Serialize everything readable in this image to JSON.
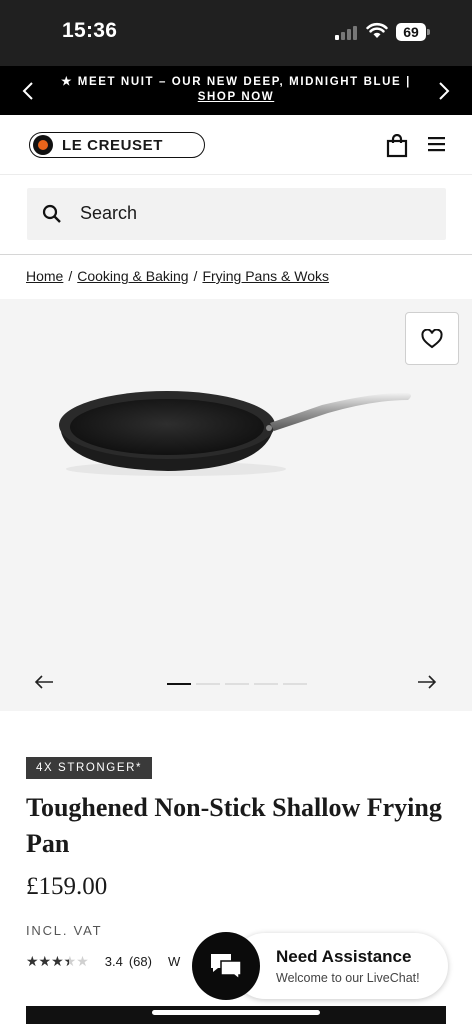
{
  "status_bar": {
    "time": "15:36",
    "battery": "69"
  },
  "promo": {
    "text": "★ MEET NUIT – OUR NEW DEEP, MIDNIGHT BLUE |",
    "link": "SHOP NOW"
  },
  "header": {
    "logo_text": "LE CREUSET"
  },
  "search": {
    "placeholder": "Search"
  },
  "breadcrumb": {
    "items": [
      "Home",
      "Cooking & Baking",
      "Frying Pans & Woks"
    ],
    "separator": "/"
  },
  "gallery": {
    "slide_count": 5,
    "active_slide": 0
  },
  "product": {
    "badge": "4X STRONGER*",
    "title": "Toughened Non-Stick Shallow Frying Pan",
    "price": "£159.00",
    "vat_note": "INCL. VAT",
    "rating": {
      "score": "3.4",
      "count": "(68)",
      "stars_value": 3.4,
      "stars_max": 5,
      "extra": "W"
    }
  },
  "livechat": {
    "title": "Need Assistance",
    "subtitle": "Welcome to our LiveChat!"
  },
  "colors": {
    "brand_orange": "#e8641b",
    "dark": "#111111",
    "badge": "#3a3a3a"
  },
  "icons": [
    "chevron-left-icon",
    "chevron-right-icon",
    "shopping-bag-icon",
    "menu-icon",
    "search-icon",
    "heart-icon",
    "arrow-left-icon",
    "arrow-right-icon",
    "chat-icon"
  ]
}
